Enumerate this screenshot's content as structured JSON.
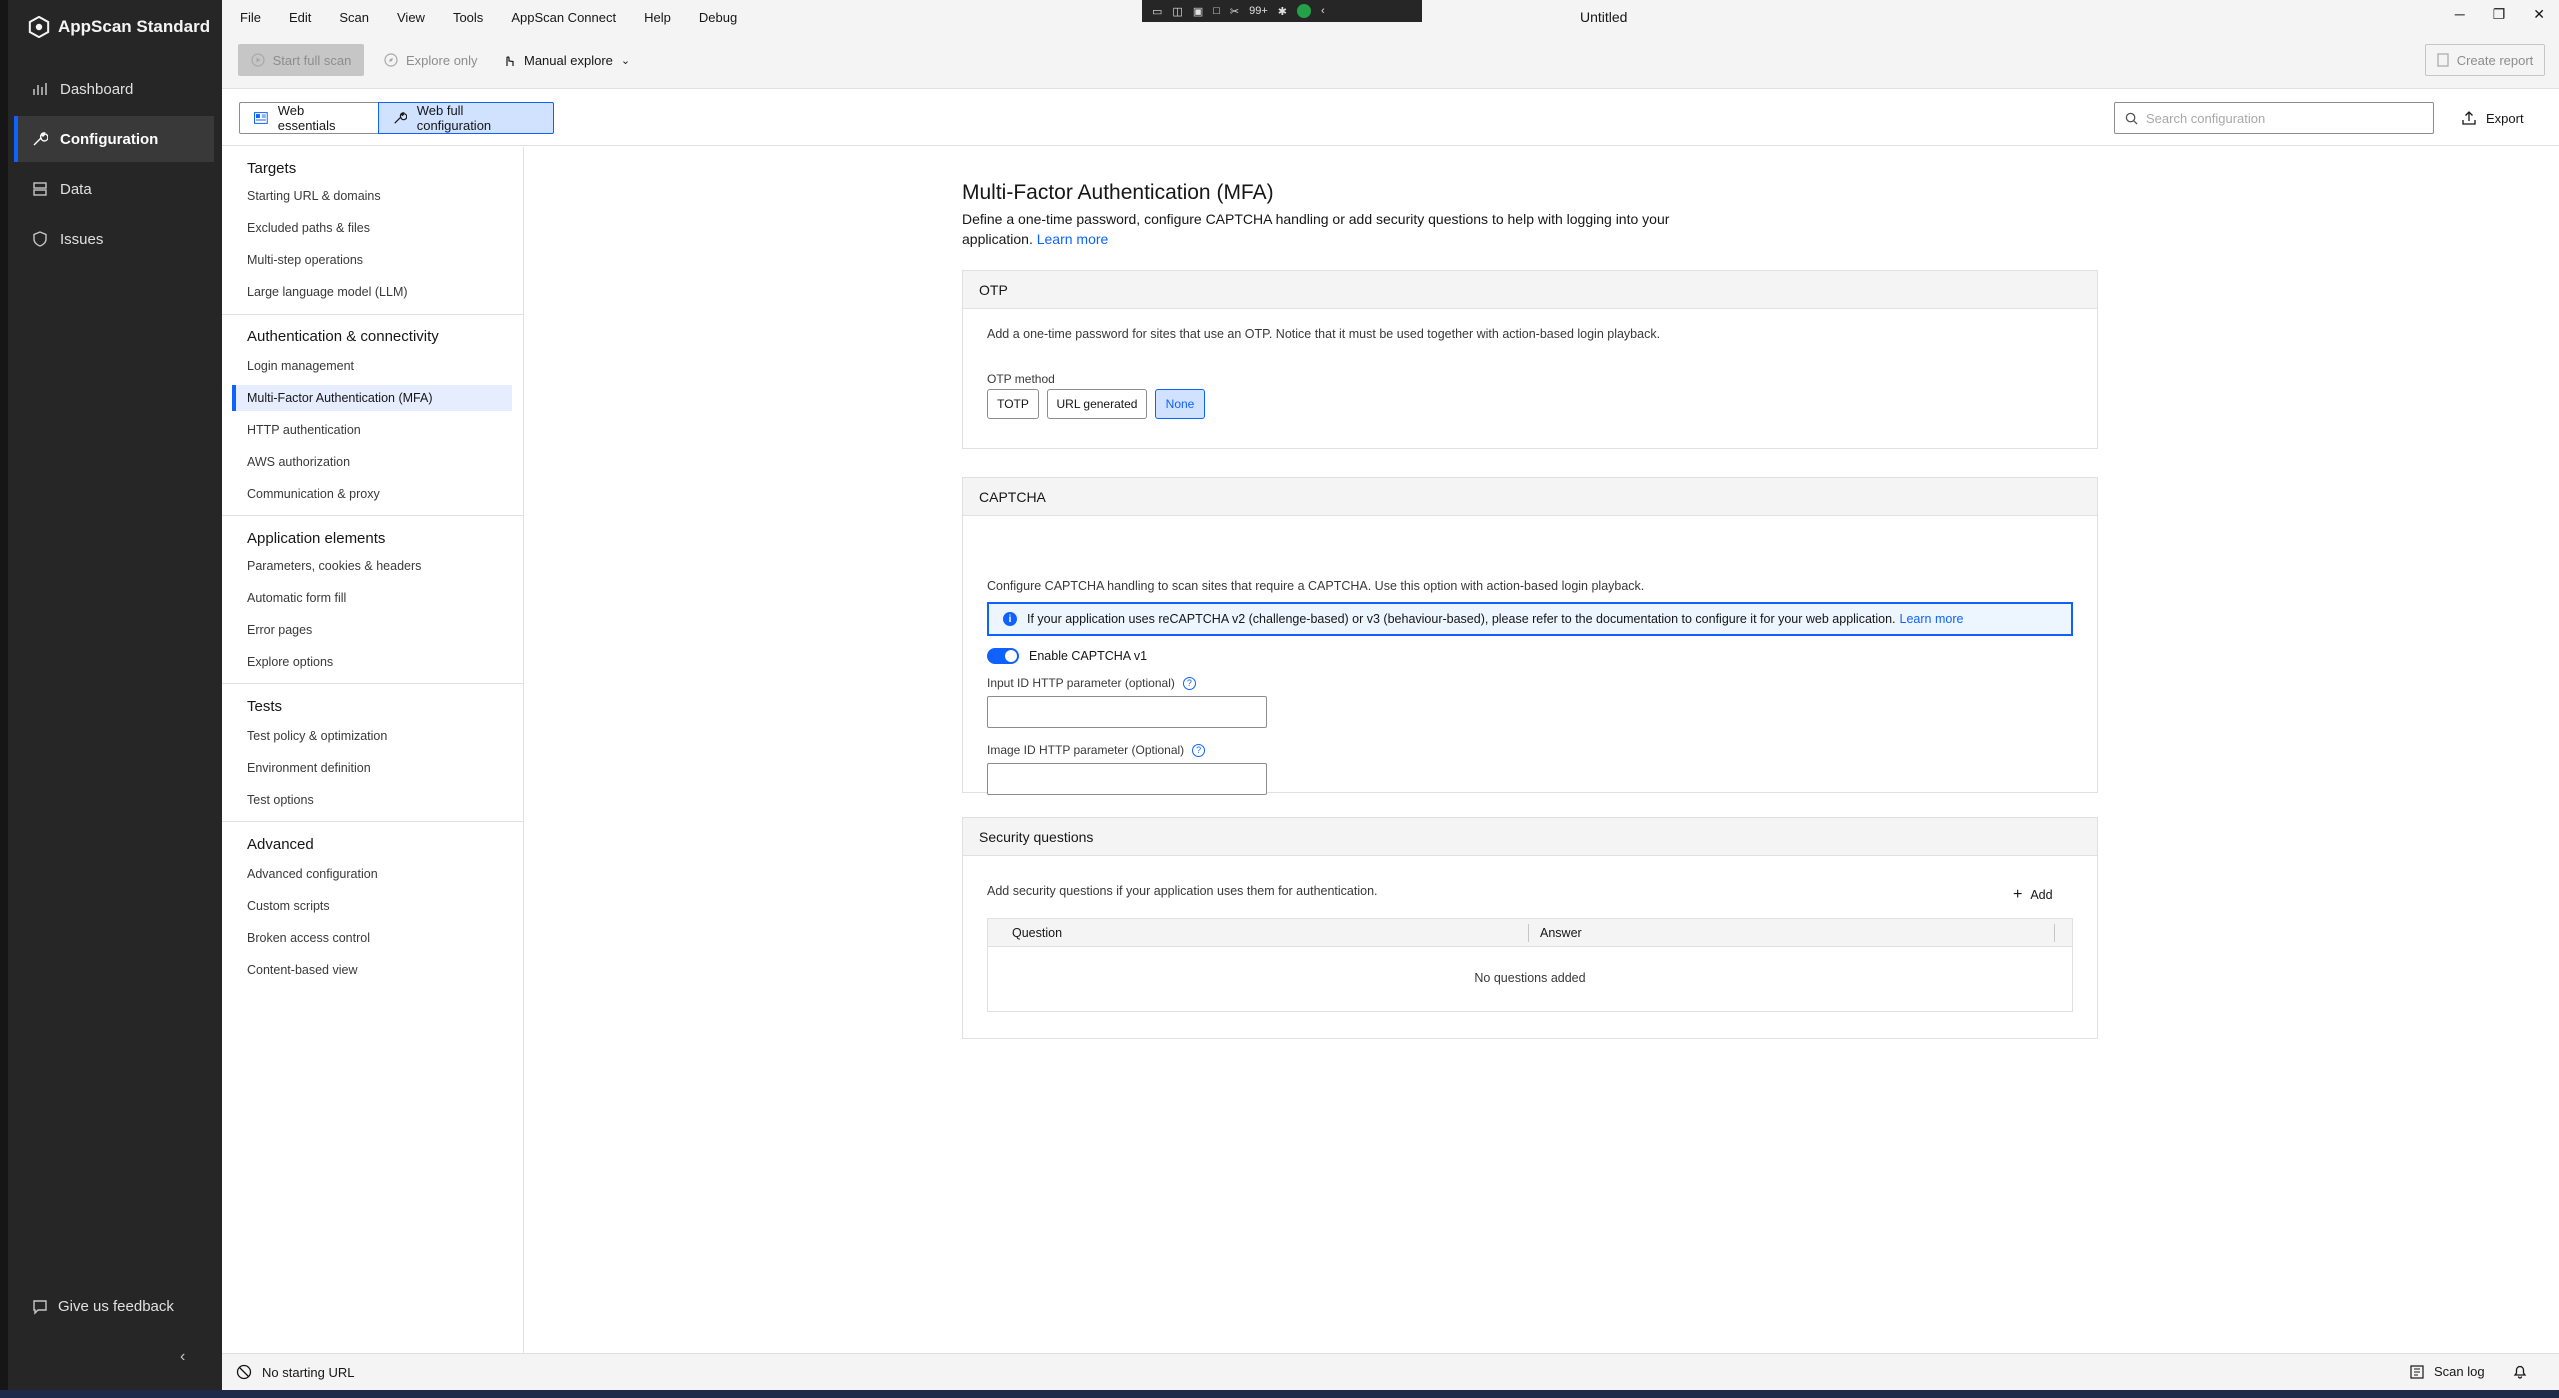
{
  "brand": {
    "name": "AppScan Standard"
  },
  "leftnav": {
    "items": [
      {
        "label": "Dashboard",
        "icon": "dashboard-icon"
      },
      {
        "label": "Configuration",
        "icon": "wrench-icon"
      },
      {
        "label": "Data",
        "icon": "database-icon"
      },
      {
        "label": "Issues",
        "icon": "shield-icon"
      }
    ],
    "active": "Configuration",
    "feedback": "Give us feedback"
  },
  "menubar": [
    "File",
    "Edit",
    "Scan",
    "View",
    "Tools",
    "AppScan Connect",
    "Help",
    "Debug"
  ],
  "tray": {
    "badge": "99+"
  },
  "window": {
    "title": "Untitled"
  },
  "toolbar": {
    "start_full_scan": "Start full scan",
    "explore_only": "Explore only",
    "manual_explore": "Manual explore",
    "create_report": "Create report"
  },
  "tabs": {
    "web_essentials": "Web essentials",
    "web_full_configuration": "Web full configuration",
    "search_placeholder": "Search configuration",
    "export": "Export"
  },
  "sidebar": {
    "groups": [
      {
        "title": "Targets",
        "items": [
          "Starting URL & domains",
          "Excluded paths & files",
          "Multi-step operations",
          "Large language model (LLM)"
        ]
      },
      {
        "title": "Authentication & connectivity",
        "items": [
          "Login management",
          "Multi-Factor Authentication (MFA)",
          "HTTP authentication",
          "AWS authorization",
          "Communication & proxy"
        ]
      },
      {
        "title": "Application elements",
        "items": [
          "Parameters, cookies & headers",
          "Automatic form fill",
          "Error pages",
          "Explore options"
        ]
      },
      {
        "title": "Tests",
        "items": [
          "Test policy & optimization",
          "Environment definition",
          "Test options"
        ]
      },
      {
        "title": "Advanced",
        "items": [
          "Advanced configuration",
          "Custom scripts",
          "Broken access control",
          "Content-based view"
        ]
      }
    ],
    "selected": "Multi-Factor Authentication (MFA)"
  },
  "page": {
    "title": "Multi-Factor Authentication (MFA)",
    "description": "Define a one-time password, configure CAPTCHA handling or add security questions to help with logging into your application.",
    "learn_more": "Learn more"
  },
  "otp": {
    "header": "OTP",
    "description": "Add a one-time password for sites that use an OTP. Notice that it must be used together with action-based login playback.",
    "method_label": "OTP method",
    "options": [
      "TOTP",
      "URL generated",
      "None"
    ],
    "selected": "None"
  },
  "captcha": {
    "header": "CAPTCHA",
    "description": "Configure CAPTCHA handling to scan sites that require a CAPTCHA. Use this option with action-based login playback.",
    "notice": "If your application uses reCAPTCHA v2 (challenge-based) or v3 (behaviour-based), please refer to the documentation to configure it for your web application.",
    "notice_link": "Learn more",
    "enable_label": "Enable CAPTCHA v1",
    "enabled": true,
    "input_id_label": "Input ID HTTP parameter (optional)",
    "input_id_value": "",
    "image_id_label": "Image ID HTTP parameter (Optional)",
    "image_id_value": ""
  },
  "security_questions": {
    "header": "Security questions",
    "description": "Add security questions if your application uses them for authentication.",
    "add_label": "Add",
    "columns": [
      "Question",
      "Answer"
    ],
    "empty": "No questions added"
  },
  "statusbar": {
    "no_starting_url": "No starting URL",
    "scan_log": "Scan log"
  },
  "colors": {
    "accent": "#0f62fe",
    "nav_bg": "#262626",
    "selected_bg": "#d0e2ff"
  }
}
